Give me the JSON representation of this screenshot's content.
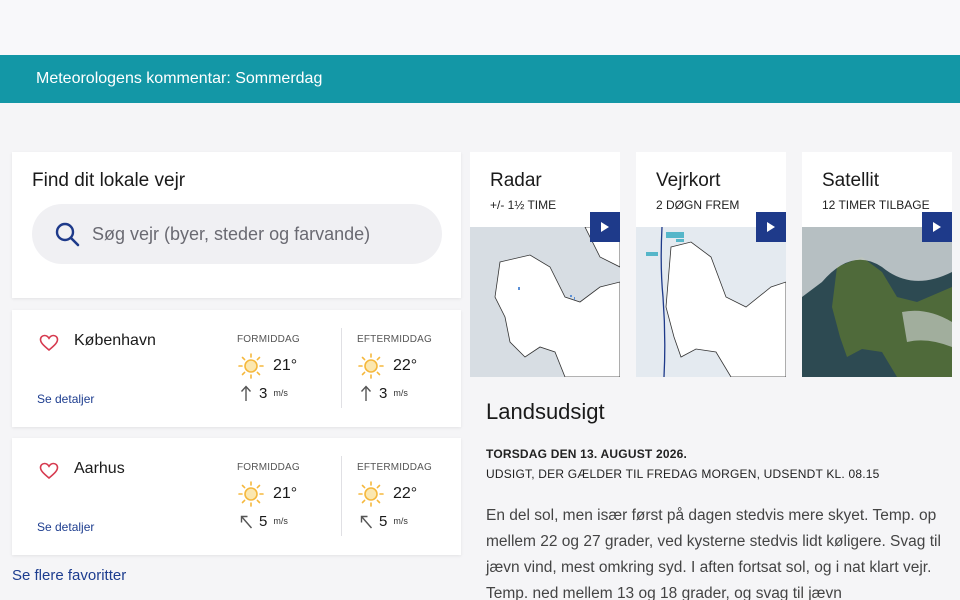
{
  "banner": {
    "text": "Meteorologens kommentar: Sommerdag"
  },
  "search": {
    "title": "Find dit lokale vejr",
    "placeholder": "Søg vejr (byer, steder og farvande)"
  },
  "favorites": [
    {
      "city": "København",
      "details_label": "Se detaljer",
      "periods": [
        {
          "label": "FORMIDDAG",
          "icon": "sun-icon",
          "temp": "21°",
          "wind_speed": "3",
          "wind_unit": "m/s",
          "wind_dir": "north-arrow"
        },
        {
          "label": "EFTERMIDDAG",
          "icon": "sun-icon",
          "temp": "22°",
          "wind_speed": "3",
          "wind_unit": "m/s",
          "wind_dir": "north-arrow"
        }
      ]
    },
    {
      "city": "Aarhus",
      "details_label": "Se detaljer",
      "periods": [
        {
          "label": "FORMIDDAG",
          "icon": "sun-icon",
          "temp": "21°",
          "wind_speed": "5",
          "wind_unit": "m/s",
          "wind_dir": "northwest-arrow"
        },
        {
          "label": "EFTERMIDDAG",
          "icon": "sun-icon",
          "temp": "22°",
          "wind_speed": "5",
          "wind_unit": "m/s",
          "wind_dir": "northwest-arrow"
        }
      ]
    }
  ],
  "more_favorites": "Se flere favoritter",
  "tiles": [
    {
      "title": "Radar",
      "subtitle": "+/- 1½ TIME"
    },
    {
      "title": "Vejrkort",
      "subtitle": "2 DØGN FREM"
    },
    {
      "title": "Satellit",
      "subtitle": "12 TIMER TILBAGE"
    }
  ],
  "outlook": {
    "title": "Landsudsigt",
    "date": "TORSDAG DEN 13. AUGUST 2026.",
    "subtitle": "UDSIGT, DER GÆLDER TIL FREDAG MORGEN, UDSENDT KL. 08.15",
    "text": "En del sol, men især først på dagen stedvis mere skyet. Temp. op mellem 22 og 27 grader, ved kysterne stedvis lidt køligere. Svag til jævn vind, mest omkring syd. I aften fortsat sol, og i nat klart vejr. Temp. ned mellem 13 og 18 grader, og svag til jævn"
  },
  "colors": {
    "banner": "#1397a6",
    "link": "#1d3d8f",
    "play_button": "#1e3a8a",
    "sun": "#f5b83d",
    "heart": "#d63a4f"
  }
}
